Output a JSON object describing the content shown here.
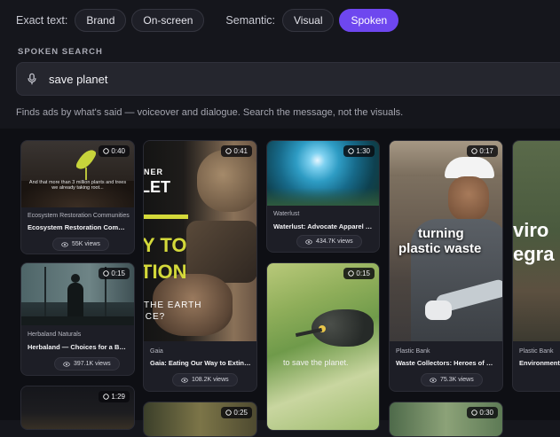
{
  "filters": {
    "exact_label": "Exact text:",
    "exact_chips": [
      "Brand",
      "On-screen"
    ],
    "semantic_label": "Semantic:",
    "semantic_chips": [
      "Visual",
      "Spoken"
    ],
    "active_chip": "Spoken"
  },
  "search": {
    "section_label": "SPOKEN SEARCH",
    "value": "save planet",
    "hint": "Finds ads by what's said — voiceover and dialogue. Search the message, not the visuals."
  },
  "cards": [
    {
      "brand": "Ecosystem Restoration Communities",
      "title": "Ecosystem Restoration Communit...",
      "views": "55K views",
      "duration": "0:40",
      "caption": "And that more than 3 million plants and trees we already taking root..."
    },
    {
      "brand": "Herbaland Naturals",
      "title": "Herbaland — Choices for a Better ...",
      "views": "397.1K views",
      "duration": "0:15"
    },
    {
      "brand": "",
      "title": "",
      "views": "",
      "duration": "1:29"
    },
    {
      "brand": "Gaia",
      "title": "Gaia: Eating Our Way to Extinction",
      "views": "108.2K views",
      "duration": "0:41",
      "overlay": [
        "NER",
        "LET",
        "Y TO",
        "TION",
        "THE EARTH",
        "ICE?"
      ]
    },
    {
      "brand": "",
      "title": "",
      "views": "",
      "duration": "0:25"
    },
    {
      "brand": "Waterlust",
      "title": "Waterlust: Advocate Apparel for O...",
      "views": "434.7K views",
      "duration": "1:30"
    },
    {
      "brand": "",
      "title": "",
      "views": "",
      "duration": "0:15",
      "caption": "to save the planet."
    },
    {
      "brand": "Plastic Bank",
      "title": "Waste Collectors: Heroes of Our Pl...",
      "views": "75.3K views",
      "duration": "0:17",
      "overlay": [
        "turning",
        "plastic waste"
      ]
    },
    {
      "brand": "",
      "title": "",
      "views": "",
      "duration": "0:30"
    },
    {
      "brand": "Plastic Bank",
      "title": "Environmental...",
      "views": "",
      "duration": "",
      "overlay": [
        "viro",
        "egra"
      ]
    }
  ]
}
